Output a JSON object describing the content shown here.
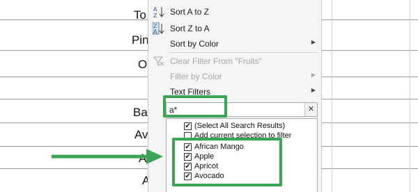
{
  "spreadsheet": {
    "cells": [
      "To",
      "Pin",
      "O",
      "Ba",
      "Av",
      "A",
      "A"
    ],
    "dropdown_glyph": "▾"
  },
  "menu": {
    "items": [
      {
        "label": "Sort A to Z",
        "icon": "sort-a-z-icon",
        "icon_glyph": "A↓Z",
        "enabled": true,
        "submenu": false
      },
      {
        "label": "Sort Z to A",
        "icon": "sort-z-a-icon",
        "icon_glyph": "Z↓A",
        "enabled": true,
        "submenu": false
      },
      {
        "label": "Sort by Color",
        "enabled": true,
        "submenu": true
      },
      {
        "label": "Clear Filter From \"Fruits\"",
        "icon": "clear-filter-icon",
        "icon_glyph": "⊽",
        "enabled": false,
        "submenu": false
      },
      {
        "label": "Filter by Color",
        "enabled": false,
        "submenu": true
      },
      {
        "label": "Text Filters",
        "enabled": true,
        "submenu": true
      }
    ],
    "submenu_arrow": "▶"
  },
  "search": {
    "value": "a*",
    "clear_glyph": "✕"
  },
  "checklist": [
    {
      "label": "(Select All Search Results)",
      "checked": true
    },
    {
      "label": "Add current selection to filter",
      "checked": false
    },
    {
      "label": "African Mango",
      "checked": true
    },
    {
      "label": "Apple",
      "checked": true
    },
    {
      "label": "Apricot",
      "checked": true
    },
    {
      "label": "Avocado",
      "checked": true
    }
  ],
  "check_glyph": "✔",
  "colors": {
    "highlight": "#3aa655",
    "icon_blue": "#2b5797"
  }
}
